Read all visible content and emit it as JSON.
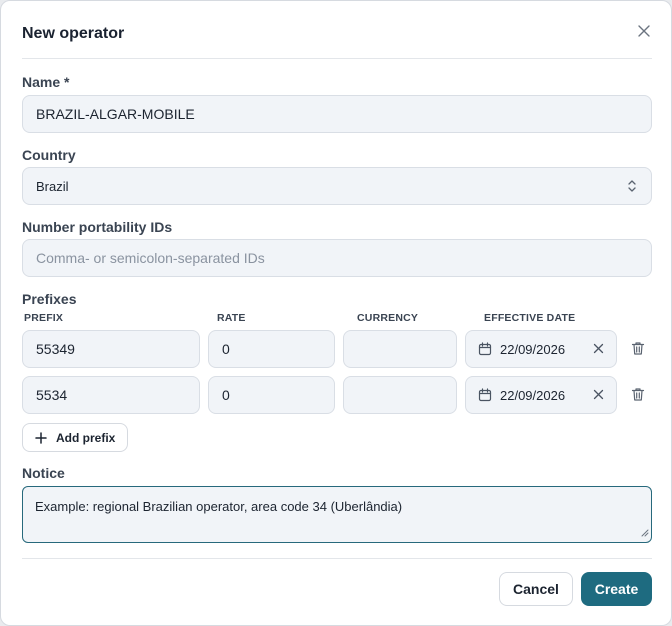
{
  "dialog": {
    "title": "New operator",
    "close_icon": "close-icon"
  },
  "fields": {
    "name": {
      "label": "Name *",
      "value": "BRAZIL-ALGAR-MOBILE"
    },
    "country": {
      "label": "Country",
      "value": "Brazil"
    },
    "portability": {
      "label": "Number portability IDs",
      "placeholder": "Comma- or semicolon-separated IDs",
      "value": ""
    }
  },
  "prefixes": {
    "label": "Prefixes",
    "columns": {
      "prefix": "PREFIX",
      "rate": "RATE",
      "currency": "CURRENCY",
      "effective_date": "EFFECTIVE DATE"
    },
    "rows": [
      {
        "prefix": "55349",
        "rate": "0",
        "currency": "",
        "effective_date": "22/09/2026"
      },
      {
        "prefix": "5534",
        "rate": "0",
        "currency": "",
        "effective_date": "22/09/2026"
      }
    ],
    "add_label": "Add prefix"
  },
  "notice": {
    "label": "Notice",
    "value": "Example: regional Brazilian operator, area code 34 (Uberlândia)"
  },
  "footer": {
    "cancel_label": "Cancel",
    "create_label": "Create"
  },
  "colors": {
    "accent": "#1e6b80",
    "field_bg": "#f1f4f8",
    "border": "#d9dee5"
  }
}
